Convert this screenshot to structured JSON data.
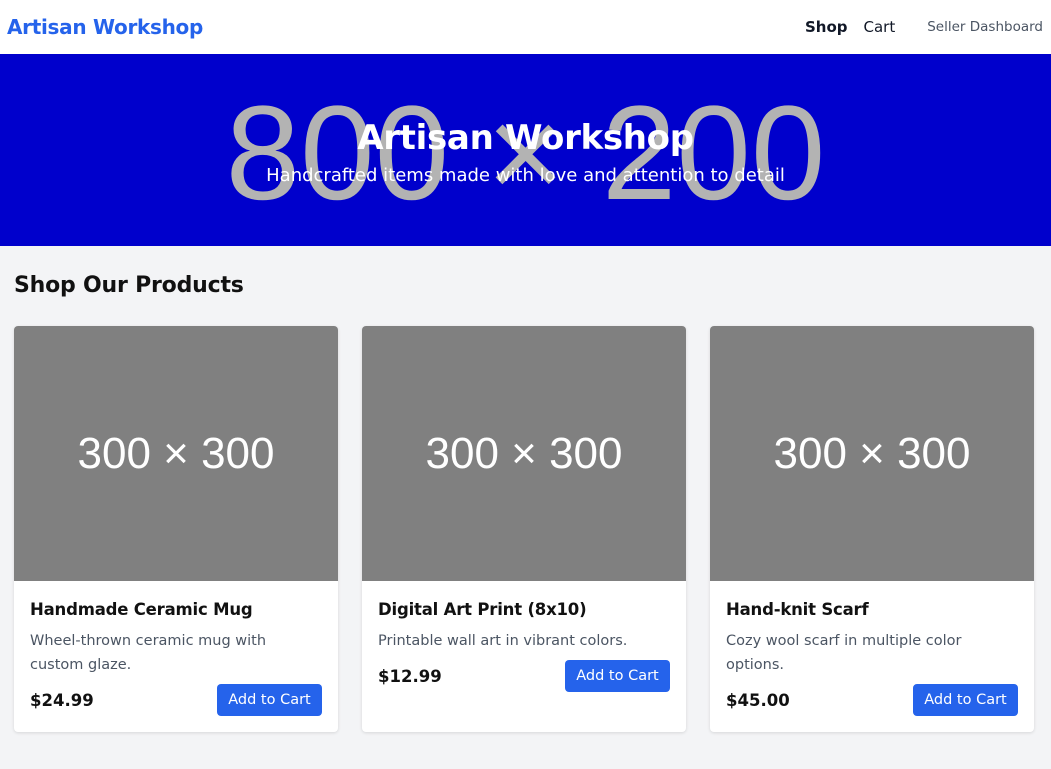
{
  "nav": {
    "brand": "Artisan Workshop",
    "links": [
      "Shop",
      "Cart",
      "Seller Dashboard"
    ]
  },
  "hero": {
    "placeholder": "800 × 200",
    "title": "Artisan Workshop",
    "subtitle": "Handcrafted items made with love and attention to detail",
    "background": "#0000cc"
  },
  "section": {
    "title": "Shop Our Products"
  },
  "products": [
    {
      "image_placeholder": "300 × 300",
      "name": "Handmade Ceramic Mug",
      "description": "Wheel-thrown ceramic mug with custom glaze.",
      "price": "$24.99",
      "button": "Add to Cart"
    },
    {
      "image_placeholder": "300 × 300",
      "name": "Digital Art Print (8x10)",
      "description": "Printable wall art in vibrant colors.",
      "price": "$12.99",
      "button": "Add to Cart"
    },
    {
      "image_placeholder": "300 × 300",
      "name": "Hand-knit Scarf",
      "description": "Cozy wool scarf in multiple color options.",
      "price": "$45.00",
      "button": "Add to Cart"
    }
  ],
  "colors": {
    "accent": "#2563eb",
    "page_bg": "#f3f4f6",
    "image_bg": "#808080"
  }
}
